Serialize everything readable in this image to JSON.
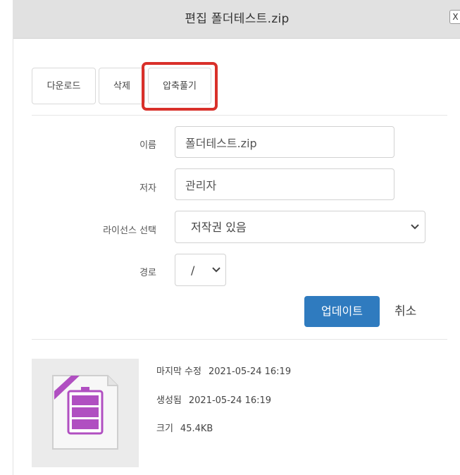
{
  "dialog": {
    "title": "편집 폴더테스트.zip",
    "close_label": "X"
  },
  "tabs": [
    {
      "label": "다운로드"
    },
    {
      "label": "삭제"
    },
    {
      "label": "압축풀기",
      "highlighted": true
    }
  ],
  "form": {
    "name_label": "이름",
    "name_value": "폴더테스트.zip",
    "author_label": "저자",
    "author_value": "관리자",
    "license_label": "라이선스 선택",
    "license_value": "저작권 있음",
    "path_label": "경로",
    "path_value": "/"
  },
  "actions": {
    "upload_label": "업데이트",
    "cancel_label": "취소"
  },
  "file_info": {
    "modified_label": "마지막 수정",
    "modified_value": "2021-05-24 16:19",
    "created_label": "생성됨",
    "created_value": "2021-05-24 16:19",
    "size_label": "크기",
    "size_value": "45.4KB",
    "icon": "zip-archive-icon"
  },
  "colors": {
    "highlight": "#d9302a",
    "primary_button": "#2f7bbf",
    "zip_icon": "#b04fc1"
  }
}
